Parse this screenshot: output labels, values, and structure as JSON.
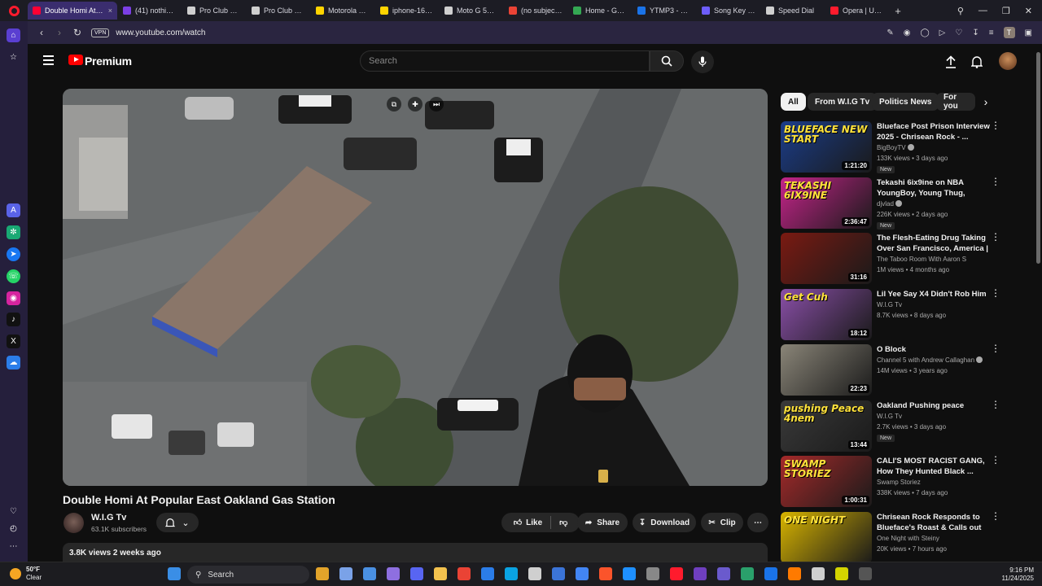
{
  "browser": {
    "tabs": [
      {
        "label": "Double Homi At Popular",
        "color": "#ff0033",
        "active": true
      },
      {
        "label": "(41) nothingb4k",
        "color": "#7b3fe4"
      },
      {
        "label": "Pro Club Men's",
        "color": "#cfcfcf"
      },
      {
        "label": "Pro Club Men's",
        "color": "#cfcfcf"
      },
      {
        "label": "Motorola moto",
        "color": "#ffd400"
      },
      {
        "label": "iphone-16-savin",
        "color": "#ffd400"
      },
      {
        "label": "Moto G 5G NFC",
        "color": "#cfcfcf"
      },
      {
        "label": "(no subject) - ty",
        "color": "#ea4335"
      },
      {
        "label": "Home - Google",
        "color": "#34a853"
      },
      {
        "label": "YTMP3 - YouTub",
        "color": "#1a73e8"
      },
      {
        "label": "Song Key & BPM",
        "color": "#6d5dfc"
      },
      {
        "label": "Speed Dial",
        "color": "#cfcfcf"
      },
      {
        "label": "Opera | Update",
        "color": "#ff1b2d"
      }
    ],
    "new_tab": "+",
    "address": "www.youtube.com/watch",
    "vpn_label": "VPN",
    "profile_initial": "T"
  },
  "youtube": {
    "brand": "Premium",
    "search_placeholder": "Search",
    "video": {
      "title": "Double Homi At Popular East Oakland Gas Station",
      "channel": "W.I.G Tv",
      "subscribers": "63.1K subscribers",
      "views_date": "3.8K views  2 weeks ago",
      "actions": {
        "like": "Like",
        "share": "Share",
        "download": "Download",
        "clip": "Clip",
        "more": "⋯"
      }
    },
    "chips": [
      "All",
      "From W.I.G Tv",
      "Politics News",
      "For you"
    ],
    "recommendations": [
      {
        "title": "Blueface Post Prison Interview 2025 - Chrisean Rock - ...",
        "channel": "BigBoyTV",
        "verified": true,
        "meta": "133K views • 3 days ago",
        "badge": "New",
        "duration": "1:21:20",
        "thumb_text": "BLUEFACE NEW START",
        "thumb_color": "#1b3d8a"
      },
      {
        "title": "Tekashi 6ix9ine on NBA YoungBoy, Young Thug, Kodak...",
        "channel": "djvlad",
        "verified": true,
        "meta": "226K views • 2 days ago",
        "badge": "New",
        "duration": "2:36:47",
        "thumb_text": "TEKASHI 6IX9INE",
        "thumb_color": "#c5248a"
      },
      {
        "title": "The Flesh-Eating Drug Taking Over San Francisco, America | ...",
        "channel": "The Taboo Room With Aaron S",
        "verified": false,
        "meta": "1M views • 4 months ago",
        "badge": "",
        "duration": "31:16",
        "thumb_text": "",
        "thumb_color": "#7a1a12"
      },
      {
        "title": "Lil Yee Say X4 Didn't Rob Him",
        "channel": "W.I.G Tv",
        "verified": false,
        "meta": "8.7K views • 8 days ago",
        "badge": "",
        "duration": "18:12",
        "thumb_text": "Get Cuh",
        "thumb_color": "#8a4fa8"
      },
      {
        "title": "O Block",
        "channel": "Channel 5 with Andrew Callaghan",
        "verified": true,
        "meta": "14M views • 3 years ago",
        "badge": "",
        "duration": "22:23",
        "thumb_text": "",
        "thumb_color": "#8a8578"
      },
      {
        "title": "Oakland Pushing peace",
        "channel": "W.I.G Tv",
        "verified": false,
        "meta": "2.7K views • 3 days ago",
        "badge": "New",
        "duration": "13:44",
        "thumb_text": "pushing Peace 4nem",
        "thumb_color": "#3a3a3a"
      },
      {
        "title": "CALI'S MOST RACIST GANG, How They Hunted Black ...",
        "channel": "Swamp Storiez",
        "verified": false,
        "meta": "338K views • 7 days ago",
        "badge": "",
        "duration": "1:00:31",
        "thumb_text": "SWAMP STORIEZ",
        "thumb_color": "#a52a2a"
      },
      {
        "title": "Chrisean Rock Responds to Blueface's Roast & Calls out C...",
        "channel": "One Night with Steiny",
        "verified": false,
        "meta": "20K views • 7 hours ago",
        "badge": "",
        "duration": "",
        "thumb_text": "ONE NIGHT",
        "thumb_color": "#d8b400"
      }
    ]
  },
  "taskbar": {
    "weather_temp": "50°F",
    "weather_desc": "Clear",
    "search": "Search",
    "time": "9:16 PM",
    "date": "11/24/2025"
  }
}
